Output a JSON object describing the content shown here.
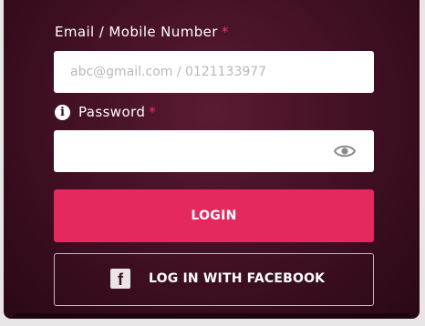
{
  "form": {
    "email_label": "Email / Mobile Number",
    "required_marker": "*",
    "email_placeholder": "abc@gmail.com / 0121133977",
    "email_value": "",
    "password_label": "Password",
    "password_value": "",
    "info_glyph": "i",
    "eye_icon": "eye-icon"
  },
  "buttons": {
    "login_label": "LOGIN",
    "facebook_label": "LOG IN WITH FACEBOOK",
    "facebook_glyph": "f"
  },
  "colors": {
    "panel_bg": "#3f0f23",
    "accent": "#e5295f",
    "required": "#e8326a",
    "field_bg": "#ffffff"
  }
}
